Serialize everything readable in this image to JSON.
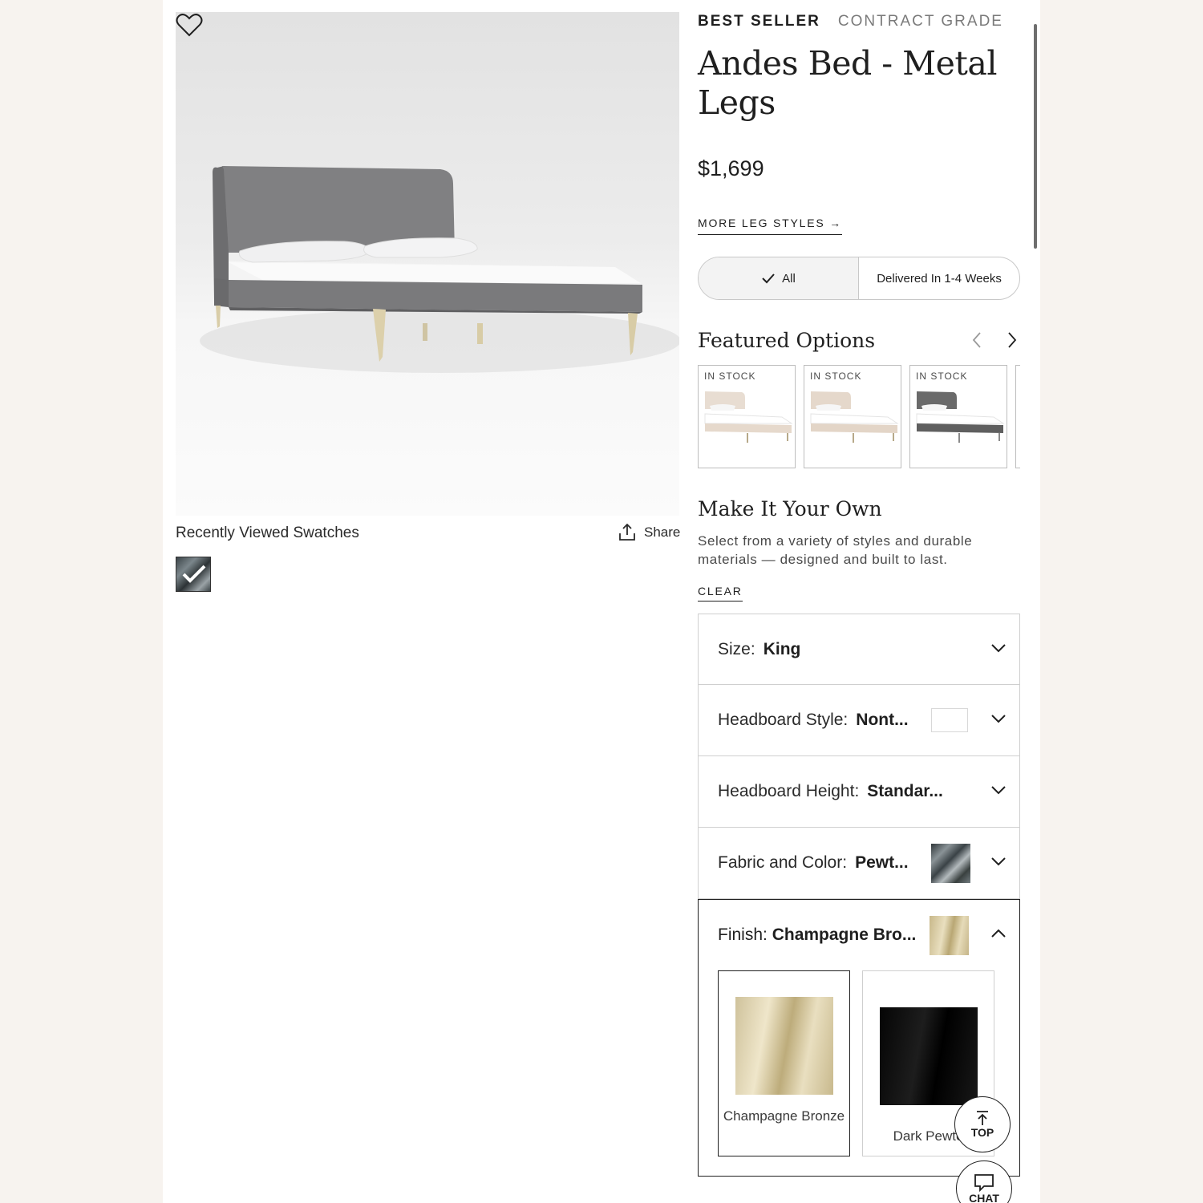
{
  "product": {
    "badges": [
      "BEST SELLER",
      "CONTRACT GRADE"
    ],
    "title": "Andes Bed - Metal Legs",
    "price": "$1,699",
    "more_leg_styles": "MORE LEG STYLES →"
  },
  "gallery": {
    "recently_viewed_label": "Recently Viewed Swatches",
    "share_label": "Share"
  },
  "delivery_filter": {
    "all_label": "All",
    "delivered_label": "Delivered In 1-4 Weeks",
    "selected": "All"
  },
  "featured": {
    "title": "Featured Options",
    "cards": [
      {
        "stock": "IN STOCK",
        "color": "#ece2d8"
      },
      {
        "stock": "IN STOCK",
        "color": "#e9ddd1"
      },
      {
        "stock": "IN STOCK",
        "color": "#6f6f6f"
      }
    ]
  },
  "customize": {
    "title": "Make It Your Own",
    "description": "Select from a variety of styles and durable materials — designed and built to last.",
    "clear_label": "CLEAR",
    "options": [
      {
        "label": "Size:",
        "value": "King"
      },
      {
        "label": "Headboard Style:",
        "value": "Nont..."
      },
      {
        "label": "Headboard Height:",
        "value": "Standar..."
      },
      {
        "label": "Fabric and Color:",
        "value": "Pewt..."
      }
    ],
    "finish": {
      "label": "Finish:",
      "value": "Champagne Bro...",
      "choices": [
        "Champagne Bronze",
        "Dark Pewte"
      ]
    }
  },
  "floating": {
    "top_label": "TOP",
    "chat_label": "CHAT"
  },
  "colors": {
    "fabric_gray": "#7d7d7f",
    "champagne_bronze": "#d8ca9f",
    "dark_pewter": "#0a0a0a"
  }
}
